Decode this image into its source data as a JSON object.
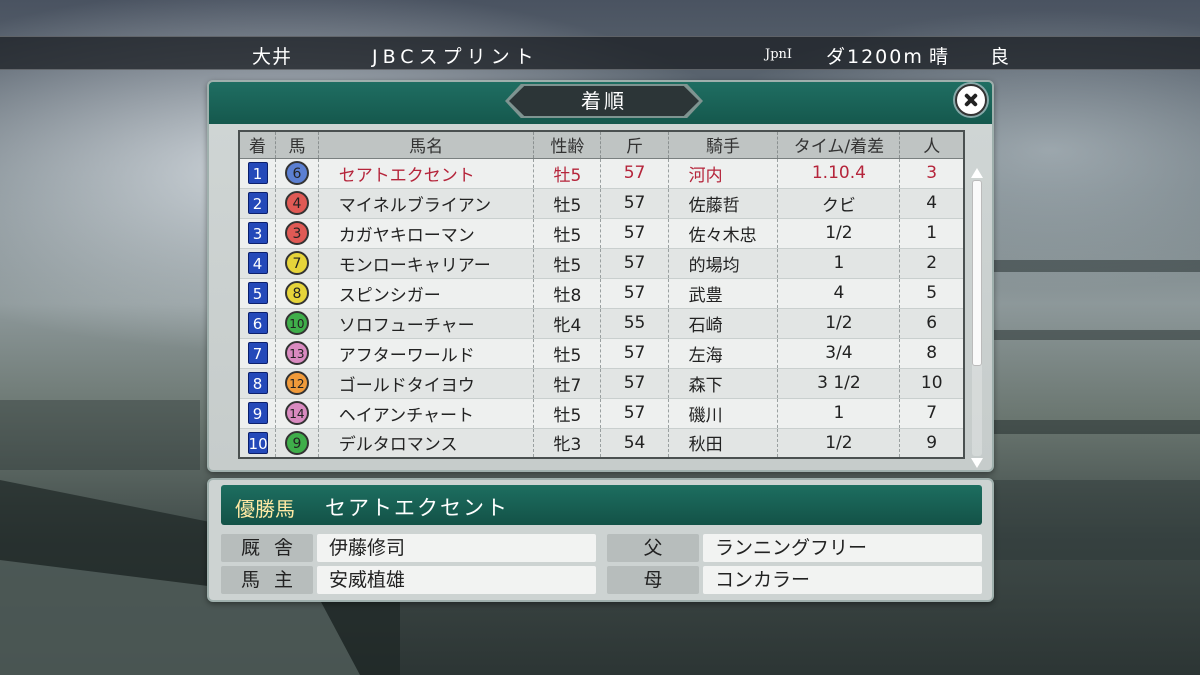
{
  "header": {
    "venue": "大井",
    "race_name": "JBCスプリント",
    "grade": "JpnⅠ",
    "distance": "ダ1200m",
    "weather": "晴",
    "track": "良"
  },
  "results": {
    "title": "着順",
    "columns": [
      "着",
      "馬",
      "馬名",
      "性齢",
      "斤",
      "騎手",
      "タイム/着差",
      "人"
    ],
    "rows": [
      {
        "rank": "1",
        "num": "6",
        "num_color": "#5b7fd1",
        "name": "セアトエクセント",
        "sexage": "牡5",
        "weight": "57",
        "jockey": "河内",
        "margin": "1.10.4",
        "pop": "3"
      },
      {
        "rank": "2",
        "num": "4",
        "num_color": "#e05a55",
        "name": "マイネルブライアン",
        "sexage": "牡5",
        "weight": "57",
        "jockey": "佐藤哲",
        "margin": "クビ",
        "pop": "4"
      },
      {
        "rank": "3",
        "num": "3",
        "num_color": "#e05a55",
        "name": "カガヤキローマン",
        "sexage": "牡5",
        "weight": "57",
        "jockey": "佐々木忠",
        "margin": "1/2",
        "pop": "1"
      },
      {
        "rank": "4",
        "num": "7",
        "num_color": "#e6d43a",
        "name": "モンローキャリアー",
        "sexage": "牡5",
        "weight": "57",
        "jockey": "的場均",
        "margin": "1",
        "pop": "2"
      },
      {
        "rank": "5",
        "num": "8",
        "num_color": "#e6d43a",
        "name": "スピンシガー",
        "sexage": "牡8",
        "weight": "57",
        "jockey": "武豊",
        "margin": "4",
        "pop": "5"
      },
      {
        "rank": "6",
        "num": "10",
        "num_color": "#3fae4a",
        "name": "ソロフューチャー",
        "sexage": "牝4",
        "weight": "55",
        "jockey": "石崎",
        "margin": "1/2",
        "pop": "6"
      },
      {
        "rank": "7",
        "num": "13",
        "num_color": "#d98ac0",
        "name": "アフターワールド",
        "sexage": "牡5",
        "weight": "57",
        "jockey": "左海",
        "margin": "3/4",
        "pop": "8"
      },
      {
        "rank": "8",
        "num": "12",
        "num_color": "#f09a3a",
        "name": "ゴールドタイヨウ",
        "sexage": "牡7",
        "weight": "57",
        "jockey": "森下",
        "margin": "3 1/2",
        "pop": "10"
      },
      {
        "rank": "9",
        "num": "14",
        "num_color": "#d98ac0",
        "name": "ヘイアンチャート",
        "sexage": "牡5",
        "weight": "57",
        "jockey": "磯川",
        "margin": "1",
        "pop": "7"
      },
      {
        "rank": "10",
        "num": "9",
        "num_color": "#3fae4a",
        "name": "デルタロマンス",
        "sexage": "牝3",
        "weight": "54",
        "jockey": "秋田",
        "margin": "1/2",
        "pop": "9"
      }
    ]
  },
  "winner": {
    "label": "優勝馬",
    "name": "セアトエクセント",
    "stable_label": "厩舎",
    "stable": "伊藤修司",
    "owner_label": "馬主",
    "owner": "安威植雄",
    "sire_label": "父",
    "sire": "ランニングフリー",
    "dam_label": "母",
    "dam": "コンカラー"
  },
  "colors": {
    "panel_green": "#1d6e60",
    "winner_text": "#b5253b",
    "rank_blue": "#2449b9"
  }
}
